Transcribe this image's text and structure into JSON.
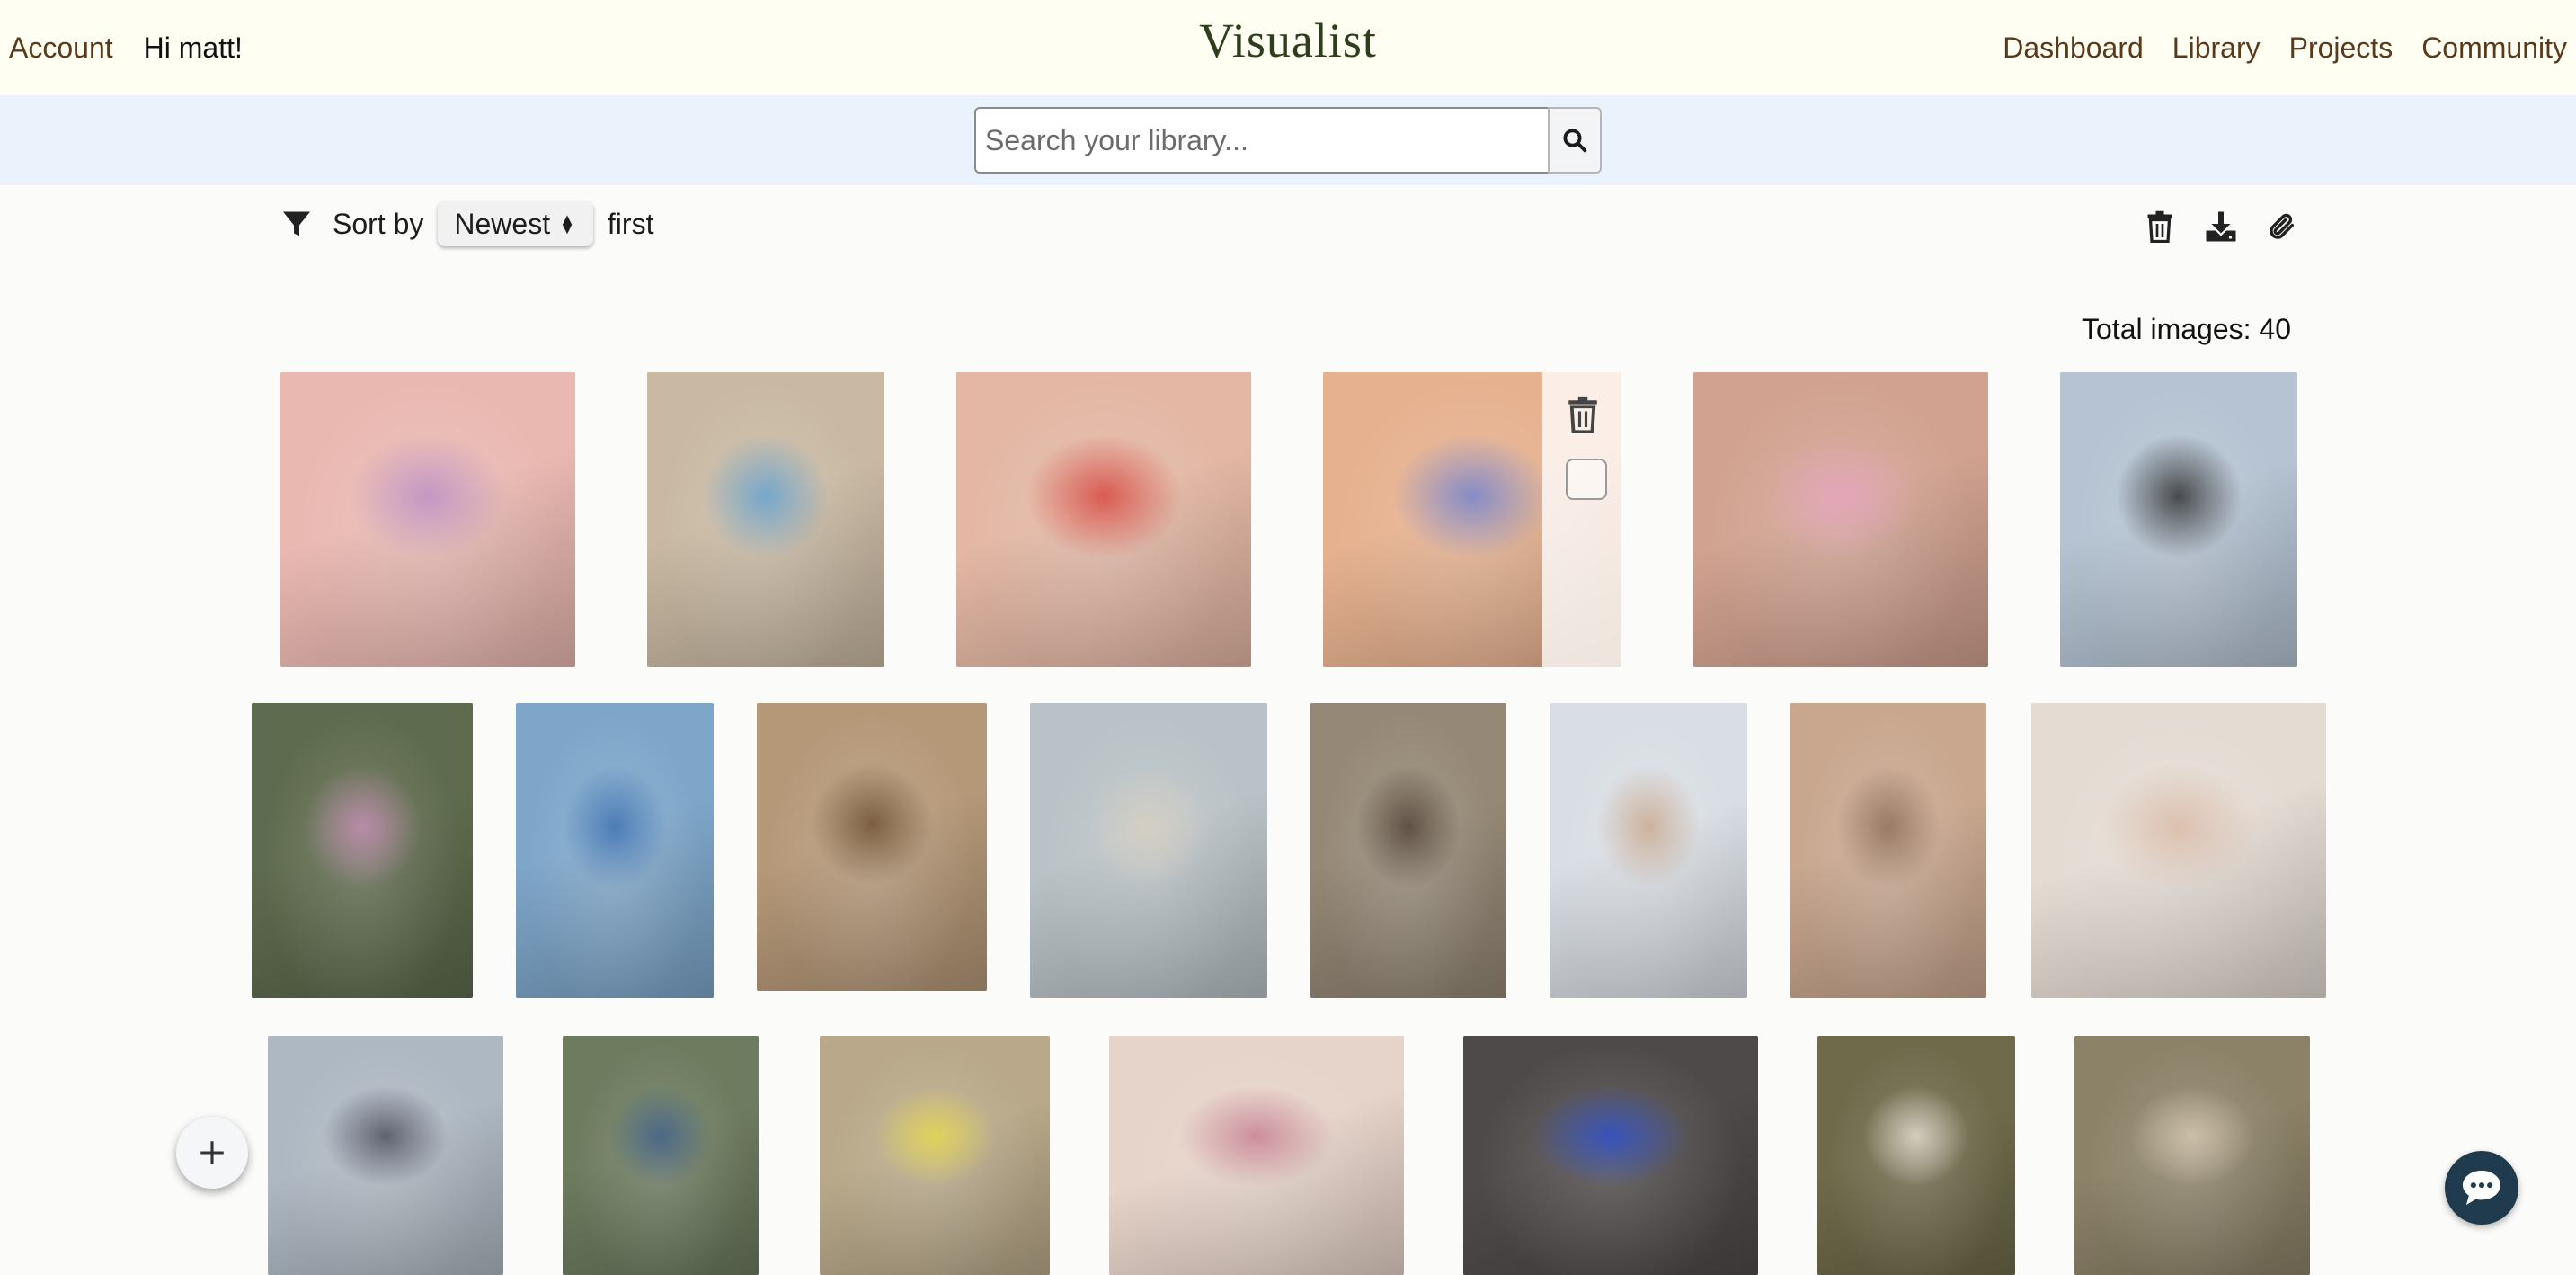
{
  "nav": {
    "account_label": "Account",
    "greeting": "Hi matt!",
    "brand": "Visualist",
    "links": [
      "Dashboard",
      "Library",
      "Projects",
      "Community"
    ]
  },
  "search": {
    "placeholder": "Search your library...",
    "value": ""
  },
  "sort": {
    "prefix": "Sort by",
    "selected": "Newest",
    "suffix": "first"
  },
  "library": {
    "total_label": "Total images: 40"
  },
  "toolbar": {
    "icons": [
      "trash-icon",
      "download-icon",
      "paperclip-icon"
    ]
  },
  "colors": {
    "nav_bg": "#fffef3",
    "nav_link": "#5a3a1c",
    "brand": "#2e3d1b",
    "search_band": "#eaf2fb",
    "chat_fab": "#1f3b4d"
  },
  "gallery": {
    "images": [
      {
        "id": "img-1",
        "tone": "#e9b8b1",
        "accent": "#b98cc6"
      },
      {
        "id": "img-2",
        "tone": "#c9b9a3",
        "accent": "#5e9fd0"
      },
      {
        "id": "img-3",
        "tone": "#e3b7a4",
        "accent": "#d5413a"
      },
      {
        "id": "img-4",
        "tone": "#e6b18f",
        "accent": "#6d7fd0",
        "hover": true
      },
      {
        "id": "img-5",
        "tone": "#d1a290",
        "accent": "#e6a3c0"
      },
      {
        "id": "img-6",
        "tone": "#b5c3d2",
        "accent": "#2a2a2a"
      },
      {
        "id": "img-7",
        "tone": "#5f6b4e",
        "accent": "#c98fb8"
      },
      {
        "id": "img-8",
        "tone": "#7ea6c9",
        "accent": "#3b6fb0"
      },
      {
        "id": "img-9",
        "tone": "#b59878",
        "accent": "#6b4d30"
      },
      {
        "id": "img-10",
        "tone": "#b9c2c6",
        "accent": "#d8cfc0"
      },
      {
        "id": "img-11",
        "tone": "#958876",
        "accent": "#4f4134"
      },
      {
        "id": "img-12",
        "tone": "#d9dee4",
        "accent": "#c7a68a"
      },
      {
        "id": "img-13",
        "tone": "#c9a78f",
        "accent": "#8b6c56"
      },
      {
        "id": "img-14",
        "tone": "#e4dbd3",
        "accent": "#d9b9a4"
      },
      {
        "id": "img-15",
        "tone": "#aeb8c2",
        "accent": "#4a4a5a"
      },
      {
        "id": "img-16",
        "tone": "#6d7b5f",
        "accent": "#3d5f8a"
      },
      {
        "id": "img-17",
        "tone": "#b9a98a",
        "accent": "#e7d94a"
      },
      {
        "id": "img-18",
        "tone": "#e6d3c9",
        "accent": "#c47b8e"
      },
      {
        "id": "img-19",
        "tone": "#4f4a4a",
        "accent": "#2c4fd0"
      },
      {
        "id": "img-20",
        "tone": "#6f6a4a",
        "accent": "#e6e1d6"
      },
      {
        "id": "img-21",
        "tone": "#8c8268",
        "accent": "#d8c9b4"
      }
    ]
  }
}
